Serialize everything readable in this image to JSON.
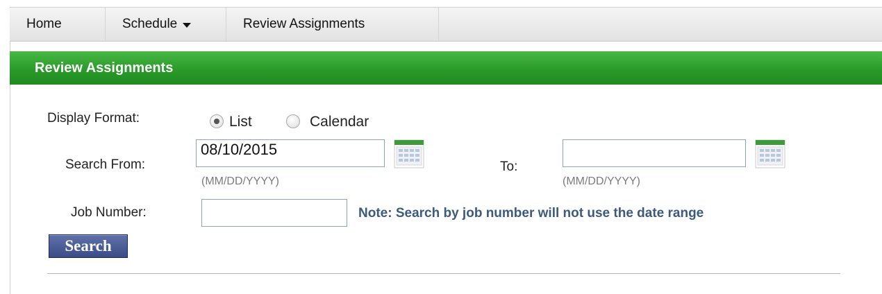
{
  "nav": {
    "home": "Home",
    "schedule": "Schedule",
    "review": "Review Assignments"
  },
  "banner": {
    "title": "Review Assignments"
  },
  "form": {
    "display_format_label": "Display Format:",
    "option_list": "List",
    "option_calendar": "Calendar",
    "selected_format": "List",
    "search_from_label": "Search From:",
    "from_value": "08/10/2015",
    "to_label": "To:",
    "to_value": "",
    "date_hint": "(MM/DD/YYYY)",
    "job_number_label": "Job Number:",
    "job_number_value": "",
    "note": "Note: Search by job number will not use the date range",
    "search_button": "Search"
  },
  "colors": {
    "banner_green": "#2a9a2a",
    "note_blue": "#3c5a7e",
    "button_blue": "#3b4c86"
  }
}
